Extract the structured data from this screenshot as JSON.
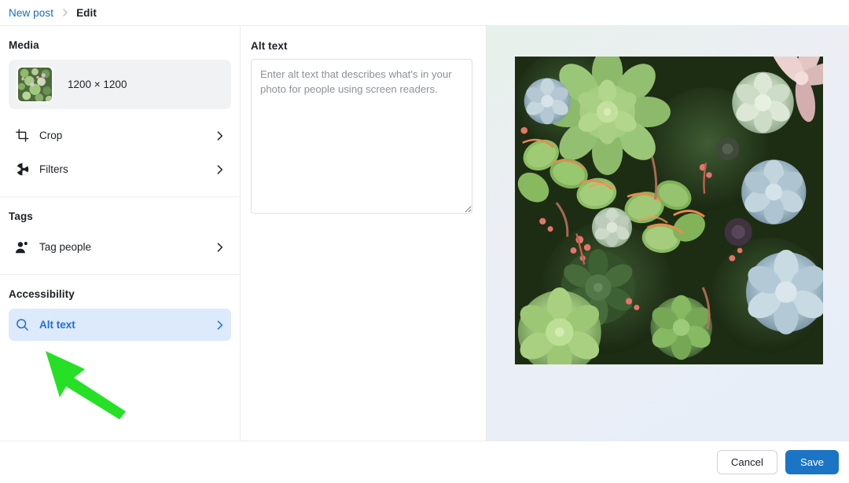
{
  "breadcrumb": {
    "root_label": "New post",
    "separator_icon": "chevron-right-icon",
    "current_label": "Edit"
  },
  "sidebar": {
    "sections": [
      {
        "title": "Media",
        "media_item": {
          "thumbnail_icon": "succulent-thumbnail",
          "dimensions": "1200 × 1200"
        },
        "rows": [
          {
            "icon": "crop-icon",
            "label": "Crop",
            "chevron": "chevron-right-icon",
            "active": false
          },
          {
            "icon": "filters-aperture-icon",
            "label": "Filters",
            "chevron": "chevron-right-icon",
            "active": false
          }
        ]
      },
      {
        "title": "Tags",
        "rows": [
          {
            "icon": "tag-people-icon",
            "label": "Tag people",
            "chevron": "chevron-right-icon",
            "active": false
          }
        ]
      },
      {
        "title": "Accessibility",
        "rows": [
          {
            "icon": "search-icon",
            "label": "Alt text",
            "chevron": "chevron-right-icon",
            "active": true
          }
        ]
      }
    ]
  },
  "alt_text_panel": {
    "title": "Alt text",
    "textarea_value": "",
    "textarea_placeholder": "Enter alt text that describes what's in your photo for people using screen readers.",
    "resize_handle_icon": "resize-handle-icon"
  },
  "preview": {
    "image_icon": "succulent-garden-photo",
    "image_alt_label": "Succulent plants garden photo preview"
  },
  "footer": {
    "cancel_label": "Cancel",
    "save_label": "Save"
  },
  "annotation": {
    "arrow_icon": "green-pointer-arrow",
    "arrow_color": "#25e025",
    "points_to": "Alt text"
  },
  "colors": {
    "link_blue": "#1c6bba",
    "accent_blue": "#1f6fd6",
    "active_row_bg": "#ddeafb",
    "save_button_blue": "#1b74c4",
    "media_card_bg": "#f1f2f3",
    "annotation_green": "#25e025"
  }
}
